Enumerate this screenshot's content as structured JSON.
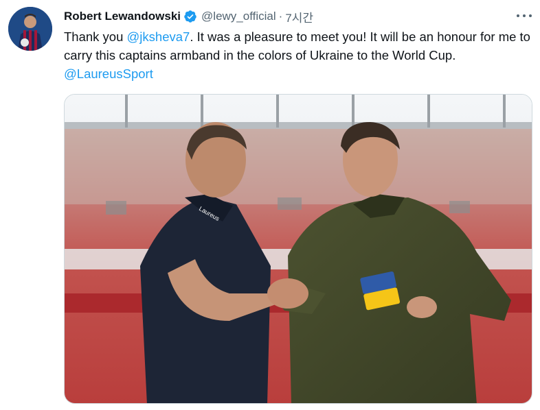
{
  "tweet": {
    "author_name": "Robert Lewandowski",
    "handle": "@lewy_official",
    "separator": "·",
    "time": "7시간",
    "text_part1": "Thank you ",
    "mention1": "@jksheva7",
    "text_part2": ". It was a pleasure to meet you! It will be an honour for me to carry this captains armband in the colors of Ukraine to the World Cup.  ",
    "mention2": "@LaureusSport",
    "verified_color": "#1d9bf0",
    "link_color": "#1d9bf0"
  },
  "icons": {
    "verified": "verified-badge-icon",
    "more": "more-options-icon"
  },
  "media": {
    "shirt_logo": "Laureus"
  }
}
